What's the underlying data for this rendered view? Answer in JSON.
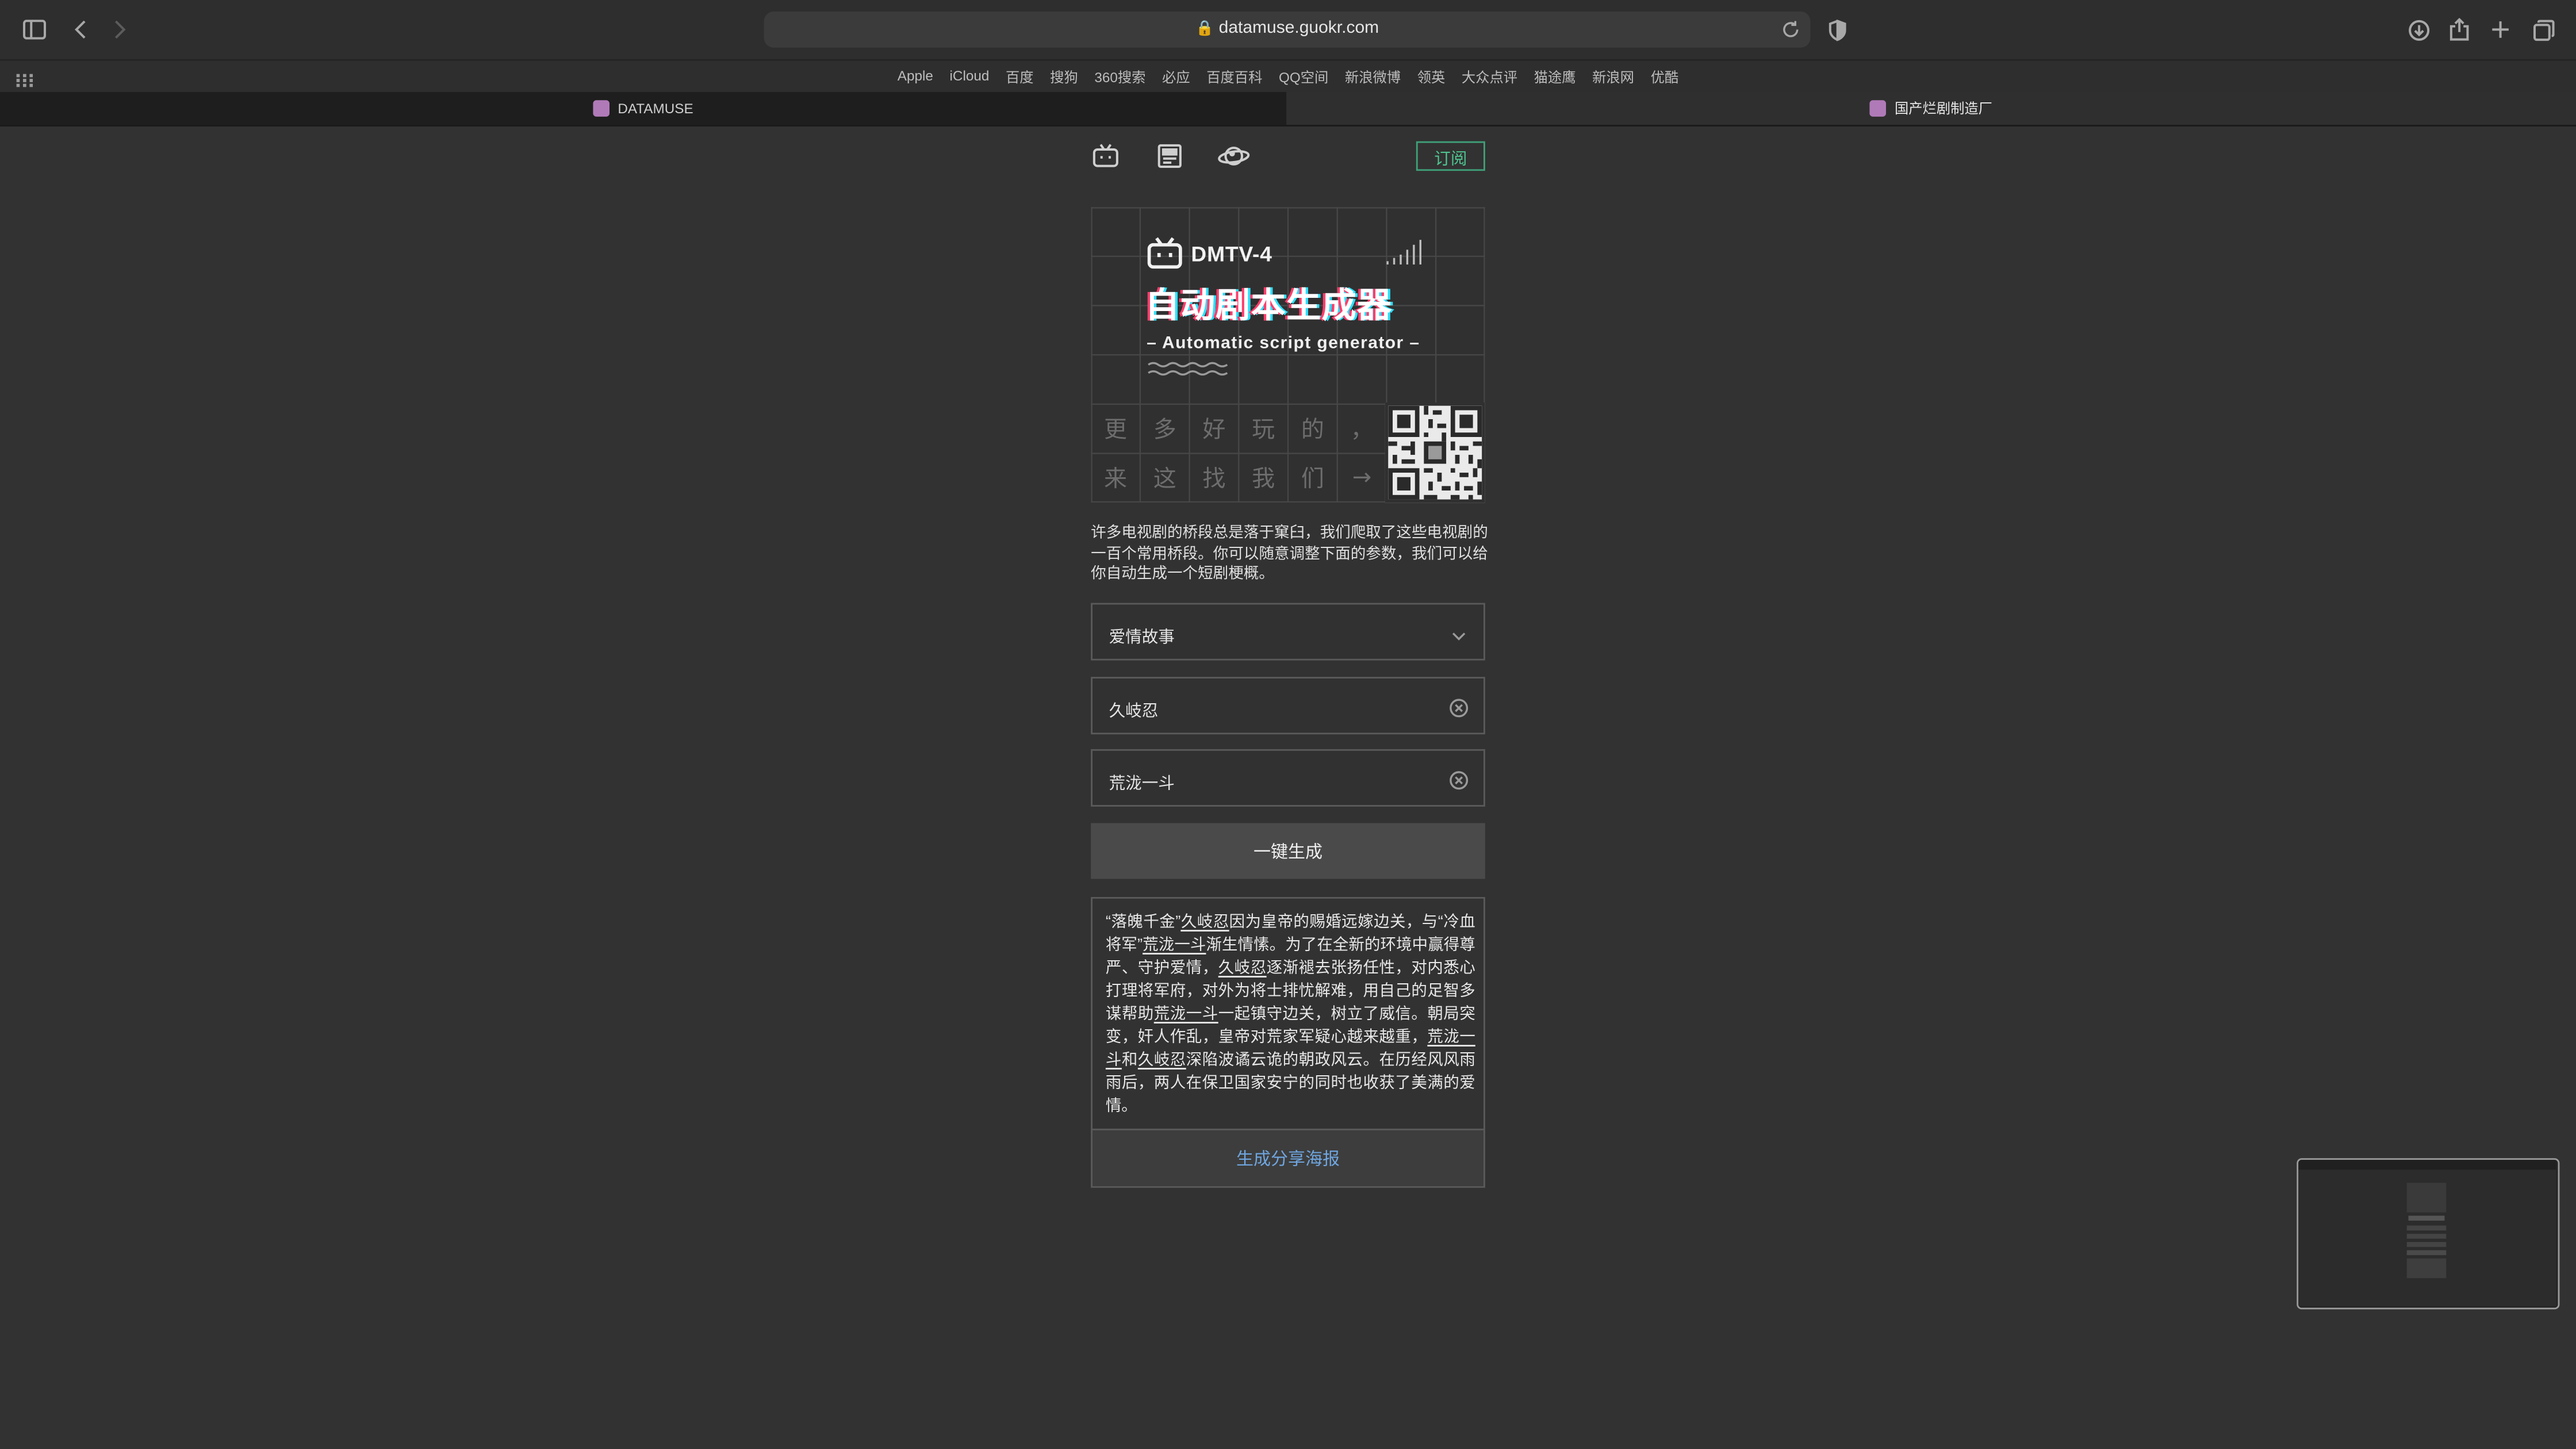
{
  "browser": {
    "url": "datamuse.guokr.com",
    "favorites": [
      "Apple",
      "iCloud",
      "百度",
      "搜狗",
      "360搜索",
      "必应",
      "百度百科",
      "QQ空间",
      "新浪微博",
      "领英",
      "大众点评",
      "猫途鹰",
      "新浪网",
      "优酷"
    ],
    "tabs": [
      {
        "title": "DATAMUSE",
        "active": true
      },
      {
        "title": "国产烂剧制造厂",
        "active": false
      }
    ]
  },
  "nav": {
    "icons": [
      "tv-icon",
      "article-icon",
      "planet-icon"
    ],
    "subscribe_label": "订阅"
  },
  "banner": {
    "logo_text": "DMTV-4",
    "title": "自动剧本生成器",
    "subtitle": "– Automatic script generator –",
    "grid_row1": [
      "更",
      "多",
      "好",
      "玩",
      "的",
      "，"
    ],
    "grid_row2": [
      "来",
      "这",
      "找",
      "我",
      "们",
      "→"
    ]
  },
  "intro": "许多电视剧的桥段总是落于窠臼，我们爬取了这些电视剧的一百个常用桥段。你可以随意调整下面的参数，我们可以给你自动生成一个短剧梗概。",
  "form": {
    "genre": "爱情故事",
    "name1": "久岐忍",
    "name2": "荒泷一斗",
    "generate_label": "一键生成"
  },
  "result": {
    "segments": [
      {
        "text": "“落魄千金”",
        "name": false
      },
      {
        "text": "久岐忍",
        "name": true
      },
      {
        "text": "因为皇帝的赐婚远嫁边关，与“冷血将军”",
        "name": false
      },
      {
        "text": "荒泷一斗",
        "name": true
      },
      {
        "text": "渐生情愫。为了在全新的环境中赢得尊严、守护爱情，",
        "name": false
      },
      {
        "text": "久岐忍",
        "name": true
      },
      {
        "text": "逐渐褪去张扬任性，对内悉心打理将军府，对外为将士排忧解难，用自己的足智多谋帮助",
        "name": false
      },
      {
        "text": "荒泷一斗",
        "name": true
      },
      {
        "text": "一起镇守边关，树立了威信。朝局突变，奸人作乱，皇帝对荒家军疑心越来越重，",
        "name": false
      },
      {
        "text": "荒泷一斗",
        "name": true
      },
      {
        "text": "和",
        "name": false
      },
      {
        "text": "久岐忍",
        "name": true
      },
      {
        "text": "深陷波谲云诡的朝政风云。在历经风风雨雨后，两人在保卫国家安宁的同时也收获了美满的爱情。",
        "name": false
      }
    ],
    "poster_label": "生成分享海报"
  },
  "colors": {
    "background": "#323232",
    "accent_green": "#4fc490",
    "link_blue": "#6fa6e0"
  }
}
